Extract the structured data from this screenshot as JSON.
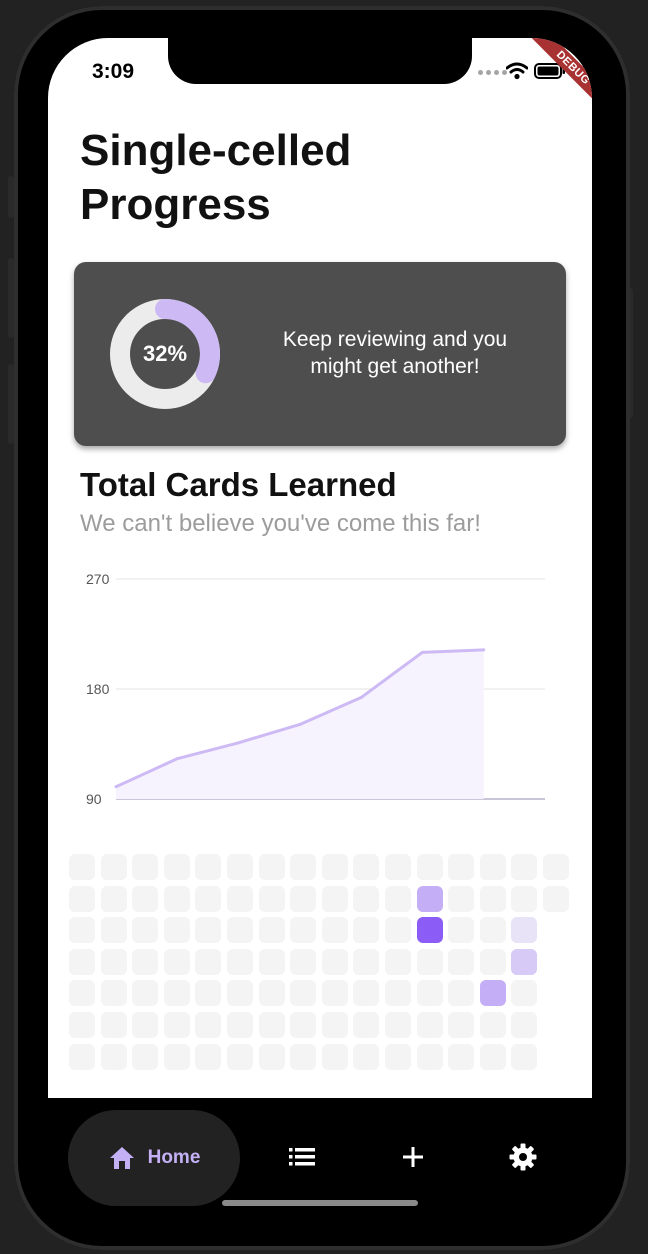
{
  "status_bar": {
    "time": "3:09",
    "debug_banner": "DEBUG"
  },
  "page": {
    "title": "Single-celled Progress"
  },
  "progress_card": {
    "percent": 32,
    "percent_label": "32%",
    "message": "Keep reviewing and you might get another!"
  },
  "cards_section": {
    "title": "Total Cards Learned",
    "subtitle": "We can't believe you've come this far!"
  },
  "chart_data": {
    "type": "area",
    "title": "",
    "xlabel": "",
    "ylabel": "",
    "ylim": [
      90,
      270
    ],
    "yticks": [
      "270",
      "180",
      "90"
    ],
    "grid": true,
    "x": [
      0,
      1,
      2,
      3,
      4,
      5,
      6,
      7
    ],
    "series": [
      {
        "values": [
          100,
          123,
          136,
          151,
          173,
          210,
          212
        ]
      }
    ],
    "colors": {
      "line": "#cdbaf5",
      "fill": "#f7f3fe",
      "grid": "#e3e3e3",
      "baseline": "#b9b2cc"
    }
  },
  "heatmap": {
    "columns": 16,
    "rows": 7,
    "levels": [
      [
        0,
        0,
        0,
        0,
        0,
        0,
        0,
        0,
        0,
        0,
        0,
        0,
        0,
        0,
        0,
        0
      ],
      [
        0,
        0,
        0,
        0,
        0,
        0,
        0,
        0,
        0,
        0,
        0,
        3,
        0,
        0,
        0,
        0
      ],
      [
        0,
        0,
        0,
        0,
        0,
        0,
        0,
        0,
        0,
        0,
        0,
        4,
        0,
        0,
        1,
        null
      ],
      [
        0,
        0,
        0,
        0,
        0,
        0,
        0,
        0,
        0,
        0,
        0,
        0,
        0,
        0,
        2,
        null
      ],
      [
        0,
        0,
        0,
        0,
        0,
        0,
        0,
        0,
        0,
        0,
        0,
        0,
        0,
        3,
        0,
        null
      ],
      [
        0,
        0,
        0,
        0,
        0,
        0,
        0,
        0,
        0,
        0,
        0,
        0,
        0,
        0,
        0,
        null
      ],
      [
        0,
        0,
        0,
        0,
        0,
        0,
        0,
        0,
        0,
        0,
        0,
        0,
        0,
        0,
        0,
        null
      ]
    ],
    "colors": [
      "#f4f4f4",
      "#e8e3f6",
      "#d7caf6",
      "#c4aef5",
      "#8b5cf6"
    ]
  },
  "bottom_nav": {
    "home_label": "Home",
    "items": [
      {
        "label": "Home",
        "icon": "home-icon",
        "active": true
      },
      {
        "icon": "list-icon"
      },
      {
        "icon": "add-icon"
      },
      {
        "icon": "settings-gear-icon"
      }
    ],
    "colors": {
      "active": "#c3b0f5",
      "icon": "#ffffff"
    }
  }
}
